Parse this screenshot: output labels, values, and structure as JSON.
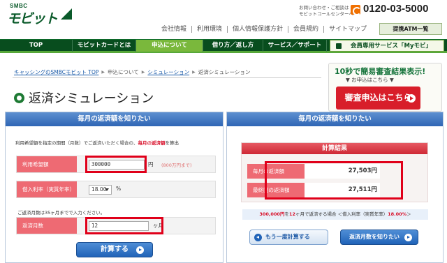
{
  "header": {
    "logo_small": "SMBC",
    "logo_main": "モビット",
    "contact_note": "お問い合わせ・ご相談は モビットコールセンターへ",
    "phone_number": "0120-03-5000",
    "util_links": [
      "会社情報",
      "利用環境",
      "個人情報保護方針",
      "会員規約",
      "サイトマップ"
    ],
    "atm_button": "提携ATM一覧"
  },
  "nav": {
    "items": [
      {
        "label": "TOP",
        "active": false
      },
      {
        "label": "モビットカードとは",
        "active": false
      },
      {
        "label": "申込について",
        "active": true
      },
      {
        "label": "借り方／返し方",
        "active": false
      },
      {
        "label": "サービス／サポート",
        "active": false
      },
      {
        "label": "会員専用サービス「Myモビ」",
        "active": false
      }
    ]
  },
  "breadcrumb": {
    "items": [
      "キャッシングのSMBCモビット TOP",
      "申込について",
      "シミュレーション",
      "返済シミュレーション"
    ]
  },
  "page_title": "返済シミュレーション",
  "promo": {
    "headline": "10秒で簡易審査結果表示!",
    "sub": "▼ お申込はこちら ▼",
    "button": "審査申込はこちら"
  },
  "left_panel": {
    "title": "毎月の返済額を知りたい",
    "description_prefix": "利用希望額を指定の期間（月数）でご返済いただく場合の、",
    "description_highlight": "毎月の返済額",
    "description_suffix": "を算出",
    "amount": {
      "label": "利用希望額",
      "value": "300000",
      "unit": "円",
      "hint": "(800万円まで)"
    },
    "rate": {
      "label": "借入利率（実質年率）",
      "value": "18.00",
      "unit": "%"
    },
    "months_note": "ご返済月数は35ヶ月までで入力ください。",
    "months": {
      "label": "返済月数",
      "value": "12",
      "unit": "ヶ月"
    },
    "calc_button": "計算する"
  },
  "right_panel": {
    "title": "毎月の返済額を知りたい",
    "result_title": "計算結果",
    "monthly_label": "毎月の返済額",
    "monthly_value": "27,503円",
    "final_label": "最終回の返済額",
    "final_value": "27,511円",
    "summary_amount": "300,000円",
    "summary_mid1": "を",
    "summary_months": "12",
    "summary_mid2": "ヶ月で返済する場合 ＜借入利率（実質年率）",
    "summary_rate": "18.00%",
    "summary_end": "＞",
    "recalc_button": "もう一度計算する",
    "months_button": "返済月数を知りたい"
  }
}
